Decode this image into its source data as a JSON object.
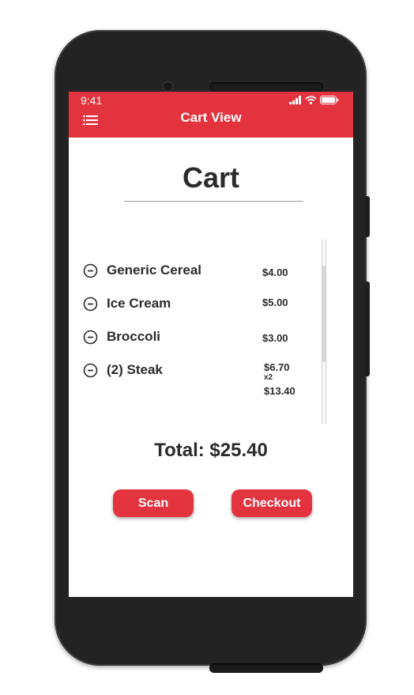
{
  "status_bar": {
    "time": "9:41"
  },
  "app_bar": {
    "title": "Cart View",
    "menu_icon": "menu-list-icon"
  },
  "page": {
    "heading": "Cart"
  },
  "cart": {
    "items": [
      {
        "name": "Generic Cereal",
        "price": "$4.00"
      },
      {
        "name": "Ice Cream",
        "price": "$5.00"
      },
      {
        "name": "Broccoli",
        "price": "$3.00"
      },
      {
        "name": "(2) Steak",
        "price": "$6.70",
        "quantity": "x2",
        "subtotal": "$13.40"
      }
    ],
    "total": "Total: $25.40"
  },
  "actions": {
    "scan_label": "Scan",
    "checkout_label": "Checkout"
  },
  "colors": {
    "accent": "#e3333f",
    "text": "#2b2b2b",
    "frame": "#232323"
  }
}
